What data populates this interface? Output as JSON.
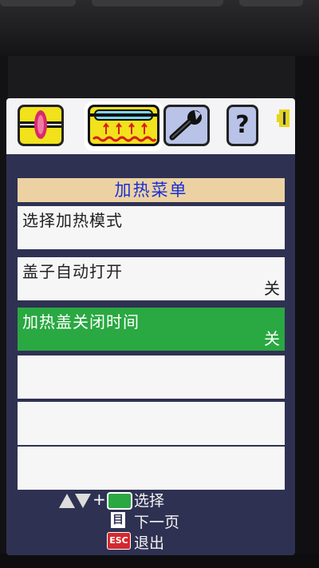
{
  "header": {
    "title": "加热菜单"
  },
  "tabs": [
    {
      "icon": "fusion-splice-icon",
      "active": false
    },
    {
      "icon": "heater-icon",
      "active": true
    },
    {
      "icon": "wrench-icon",
      "active": false
    },
    {
      "icon": "help-icon",
      "label": "?",
      "active": false
    }
  ],
  "battery": {
    "icon": "battery-icon",
    "color": "#e5d51c"
  },
  "menu": {
    "items": [
      {
        "label": "选择加热模式",
        "value": ""
      },
      {
        "label": "盖子自动打开",
        "value": "关"
      },
      {
        "label": "加热盖关闭时间",
        "value": "关",
        "selected": true
      },
      {
        "label": "",
        "value": ""
      },
      {
        "label": "",
        "value": ""
      },
      {
        "label": "",
        "value": ""
      }
    ]
  },
  "footer": {
    "select": {
      "plus": "+",
      "text": "选择"
    },
    "next_page": {
      "key_glyph": "目",
      "text": "下一页"
    },
    "exit": {
      "key_label": "ESC",
      "text": "退出"
    }
  },
  "colors": {
    "screen_bg": "#2f3152",
    "header_bg": "#ecd2a3",
    "header_text": "#1a2fd6",
    "selected_row": "#2aa842",
    "tab_yellow": "#f1e21b",
    "tab_blue": "#b9c3e8"
  }
}
